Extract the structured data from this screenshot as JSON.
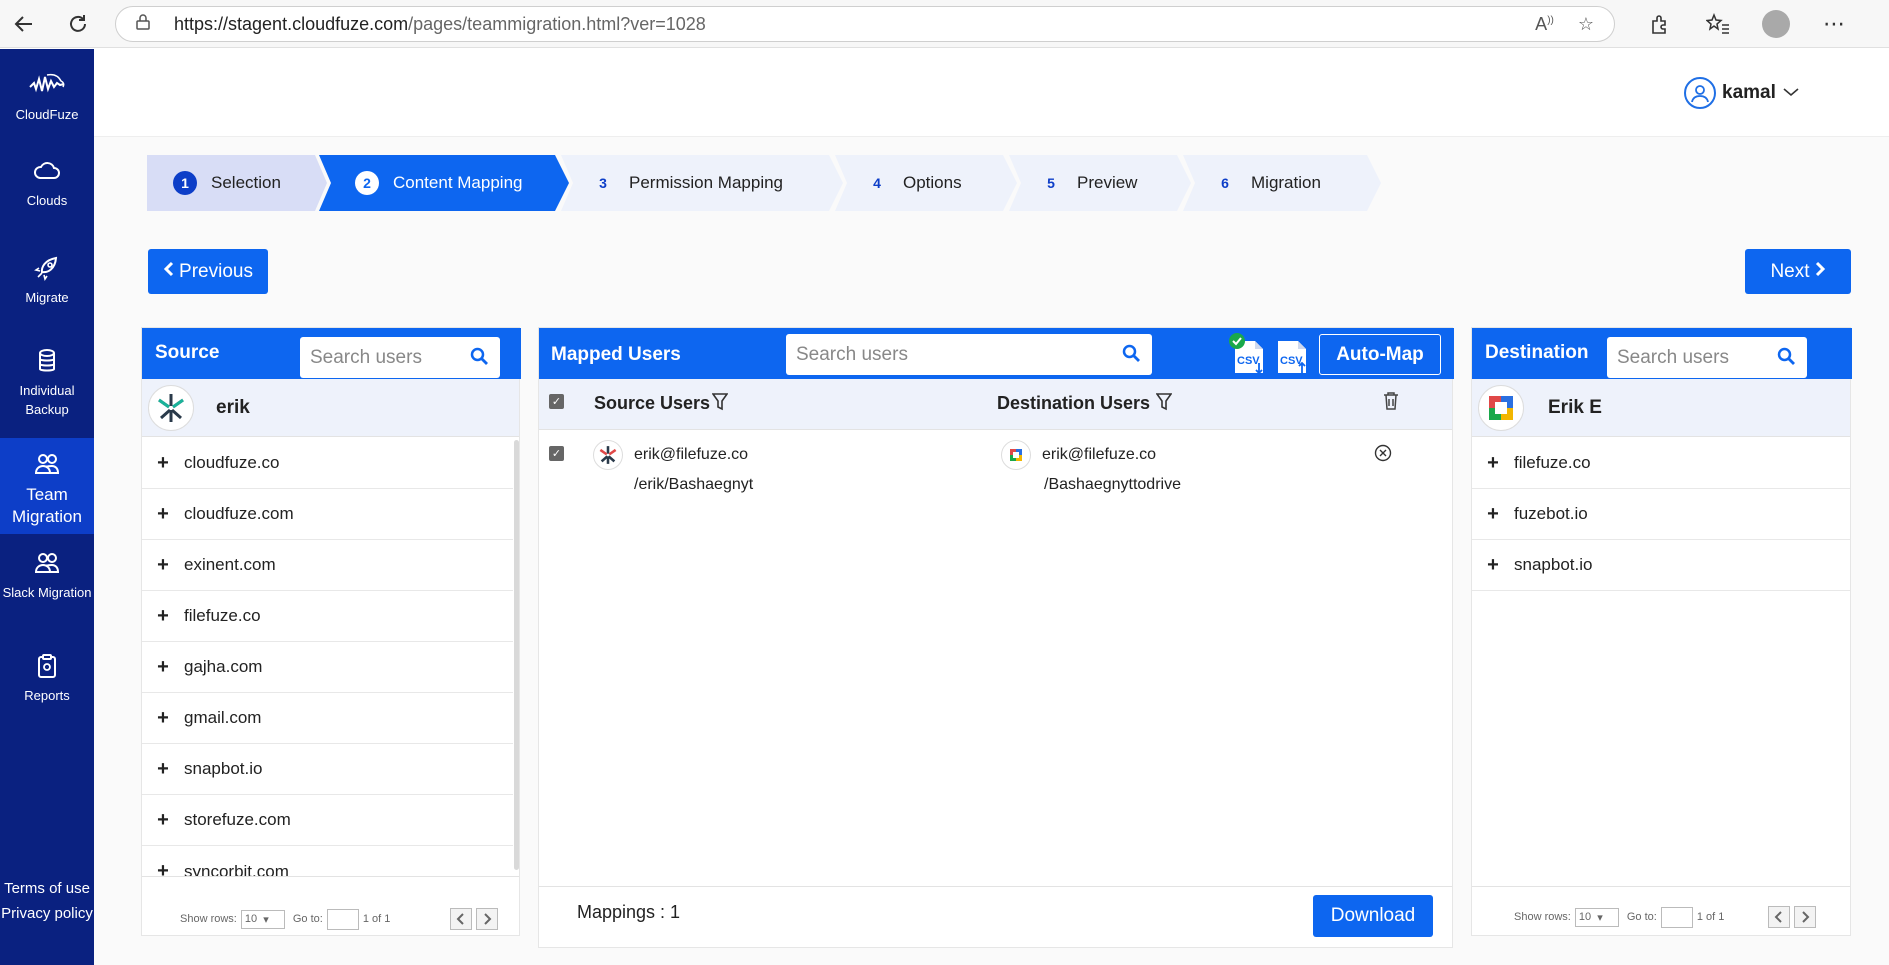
{
  "browser": {
    "url_host": "https://stagent.cloudfuze.com",
    "url_path": "/pages/teammigration.html?ver=1028"
  },
  "sidebar": {
    "brand": "CloudFuze",
    "items": [
      {
        "label": "Clouds",
        "icon": "cloud-icon"
      },
      {
        "label": "Migrate",
        "icon": "rocket-icon"
      },
      {
        "label": "Individual Backup",
        "icon": "database-icon"
      },
      {
        "label": "Team Migration",
        "icon": "team-icon"
      },
      {
        "label": "Slack Migration",
        "icon": "users-icon"
      },
      {
        "label": "Reports",
        "icon": "clipboard-icon"
      }
    ],
    "terms": "Terms of use",
    "privacy": "Privacy policy"
  },
  "user": {
    "name": "kamal"
  },
  "steps": [
    {
      "num": "1",
      "label": "Selection"
    },
    {
      "num": "2",
      "label": "Content Mapping"
    },
    {
      "num": "3",
      "label": "Permission Mapping"
    },
    {
      "num": "4",
      "label": "Options"
    },
    {
      "num": "5",
      "label": "Preview"
    },
    {
      "num": "6",
      "label": "Migration"
    }
  ],
  "nav": {
    "previous": "Previous",
    "next": "Next"
  },
  "source": {
    "title": "Source",
    "search_placeholder": "Search users",
    "user": "erik",
    "domains": [
      "cloudfuze.co",
      "cloudfuze.com",
      "exinent.com",
      "filefuze.co",
      "gajha.com",
      "gmail.com",
      "snapbot.io",
      "storefuze.com",
      "syncorbit.com"
    ],
    "pager": {
      "show_rows": "Show rows:",
      "rows": "10",
      "goto": "Go to:",
      "page": "1",
      "of": "1 of 1"
    }
  },
  "mapped": {
    "title": "Mapped Users",
    "search_placeholder": "Search users",
    "csv1": "CSV",
    "csv2": "CSV",
    "automap": "Auto-Map",
    "col_source": "Source Users",
    "col_dest": "Destination Users",
    "rows": [
      {
        "source_email": "erik@filefuze.co",
        "source_path": "/erik/Bashaegnyt",
        "dest_email": "erik@filefuze.co",
        "dest_path": "/Bashaegnyttodrive"
      }
    ],
    "mappings": "Mappings : 1",
    "download": "Download"
  },
  "destination": {
    "title": "Destination",
    "search_placeholder": "Search users",
    "user": "Erik E",
    "domains": [
      "filefuze.co",
      "fuzebot.io",
      "snapbot.io"
    ],
    "pager": {
      "show_rows": "Show rows:",
      "rows": "10",
      "goto": "Go to:",
      "page": "1",
      "of": "1 of 1"
    }
  },
  "colors": {
    "sidebar": "#0a2180",
    "accent": "#0d66f0",
    "step_active": "#0d66f0",
    "step_done": "#d8ddf6",
    "step_pending": "#eef2fb"
  }
}
